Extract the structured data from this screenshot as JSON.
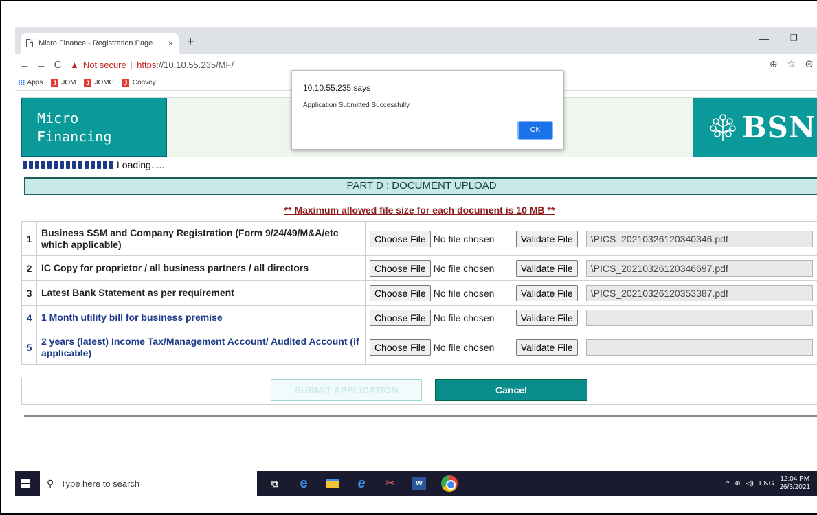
{
  "browser": {
    "tab_title": "Micro Finance - Registration Page",
    "tab_close": "×",
    "new_tab": "+",
    "minimize": "—",
    "maximize": "❐",
    "back": "←",
    "forward": "→",
    "reload": "C",
    "not_secure": "Not secure",
    "separator": "|",
    "url_scheme": "https",
    "url_rest": "://10.10.55.235/MF/",
    "zoom_icon": "⊕",
    "star_icon": "☆",
    "profile_icon": "Θ",
    "bookmarks": [
      {
        "label": "Apps"
      },
      {
        "label": "JOM"
      },
      {
        "label": "JOMC"
      },
      {
        "label": "Convey"
      }
    ]
  },
  "dialog": {
    "title": "10.10.55.235 says",
    "message": "Application Submitted Successfully",
    "ok_label": "OK"
  },
  "banner": {
    "left_line1": "Micro",
    "left_line2": "Financing",
    "logo_text": "BSN"
  },
  "loading_text": "Loading.....",
  "part_header": "PART D : DOCUMENT UPLOAD",
  "max_note": "** Maximum allowed file size for each document is 10 MB **",
  "documents": [
    {
      "num": "1",
      "desc": "Business SSM and Company Registration (Form 9/24/49/M&A/etc which applicable)",
      "choose": "Choose File",
      "no_file": "No file chosen",
      "validate": "Validate File",
      "path": "\\PICS_20210326120340346.pdf"
    },
    {
      "num": "2",
      "desc": "IC Copy for proprietor / all business partners / all directors",
      "choose": "Choose File",
      "no_file": "No file chosen",
      "validate": "Validate File",
      "path": "\\PICS_20210326120346697.pdf"
    },
    {
      "num": "3",
      "desc": "Latest Bank Statement as per requirement",
      "choose": "Choose File",
      "no_file": "No file chosen",
      "validate": "Validate File",
      "path": "\\PICS_20210326120353387.pdf"
    },
    {
      "num": "4",
      "desc": "1 Month utility bill for business premise",
      "choose": "Choose File",
      "no_file": "No file chosen",
      "validate": "Validate File",
      "path": ""
    },
    {
      "num": "5",
      "desc": "2 years (latest) Income Tax/Management Account/ Audited Account (if applicable)",
      "choose": "Choose File",
      "no_file": "No file chosen",
      "validate": "Validate File",
      "path": ""
    }
  ],
  "actions": {
    "submit_label": "SUBMIT APPLICATION",
    "cancel_label": "Cancel"
  },
  "taskbar": {
    "search_placeholder": "Type here to search",
    "lang": "ENG",
    "time": "12:04 PM",
    "date": "26/3/2021"
  },
  "colors": {
    "teal": "#0b9a9a",
    "dark_blue_text": "#1e3a8a",
    "note_red": "#8b1a1a"
  }
}
